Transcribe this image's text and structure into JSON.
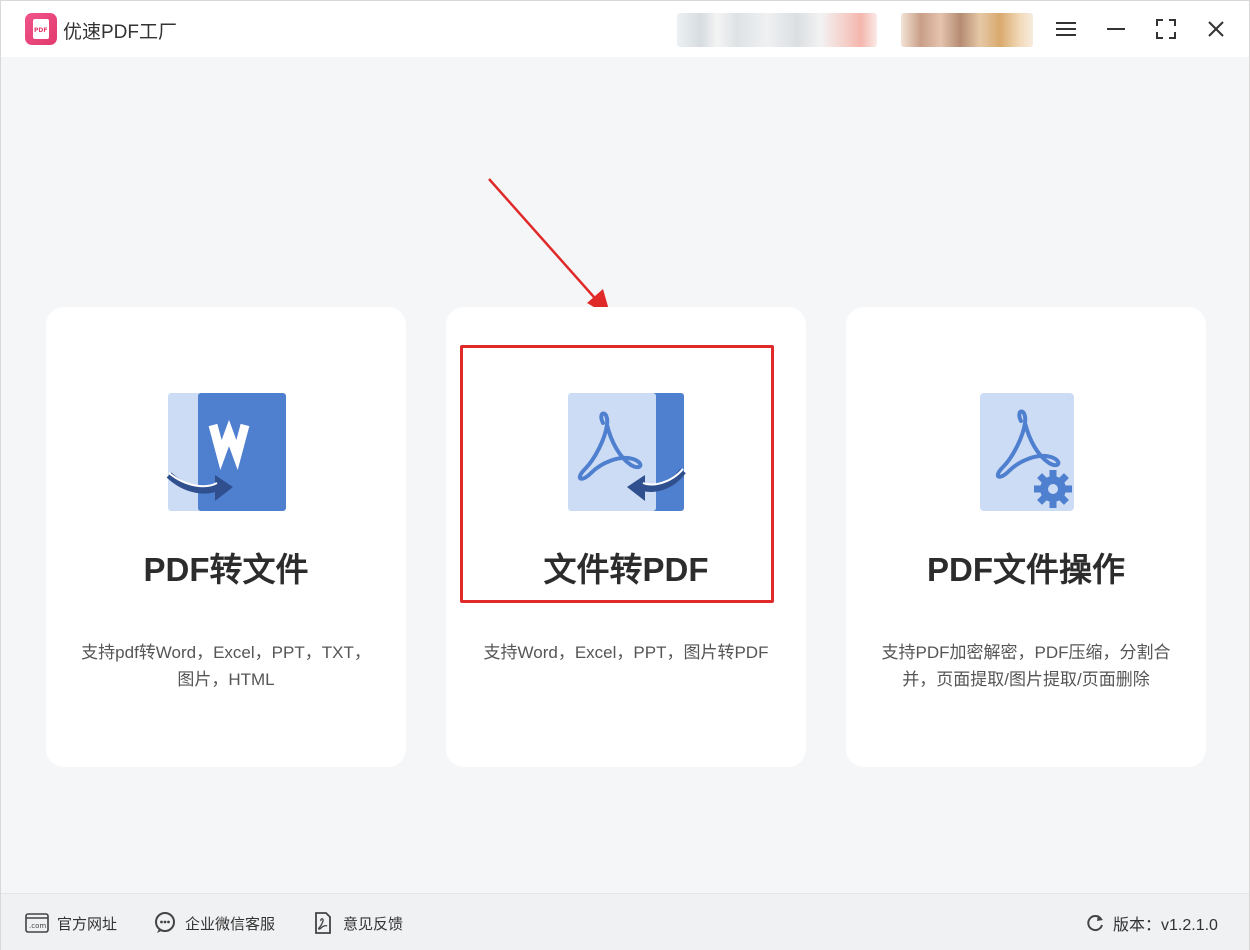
{
  "app": {
    "title": "优速PDF工厂",
    "logo_text": "PDF"
  },
  "window_controls": {
    "menu_icon": "menu-icon",
    "minimize_icon": "minimize-icon",
    "maximize_icon": "maximize-icon",
    "close_icon": "close-icon"
  },
  "cards": [
    {
      "title": "PDF转文件",
      "desc_line1": "支持pdf转Word，Excel，PPT，TXT，",
      "desc_line2": "图片，HTML",
      "icon": "word-convert-icon"
    },
    {
      "title": "文件转PDF",
      "desc_line1": "支持Word，Excel，PPT，图片转PDF",
      "desc_line2": "",
      "icon": "pdf-convert-icon"
    },
    {
      "title": "PDF文件操作",
      "desc_line1": "支持PDF加密解密，PDF压缩，分割合",
      "desc_line2": "并，页面提取/图片提取/页面删除",
      "icon": "pdf-settings-icon"
    }
  ],
  "footer": {
    "website": "官方网址",
    "wechat_support": "企业微信客服",
    "feedback": "意见反馈",
    "version": "版本：v1.2.1.0",
    "website_icon_text": ".com"
  },
  "colors": {
    "annotation_red": "#e02a2a",
    "icon_blue": "#4f7fcf",
    "icon_light_blue": "#cddcf5",
    "accent_pink": "#e23a6d"
  }
}
